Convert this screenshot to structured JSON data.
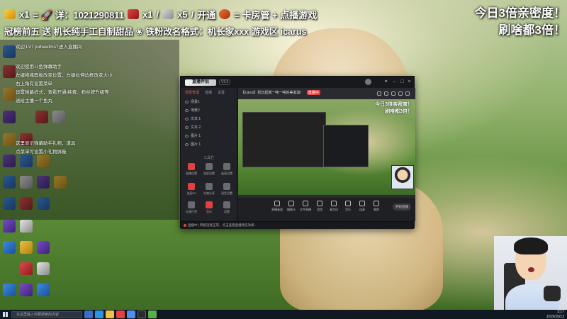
{
  "top_banner": {
    "line1": {
      "gift_count_1": "x1",
      "text": "= 🚀 详：1021290811",
      "gift_count_2": "x1",
      "gift_count_3": "x5",
      "open_text": "开通",
      "equals_card": "= 卡房管 + 点播游戏"
    },
    "line2": "冠榜前五 送 机长纯手工自制甜品 ❀ 铁粉改名格式：机长家xxx 游戏区 icarus"
  },
  "top_right": {
    "line1": "今日3倍亲密度！",
    "line2": "刷啥都3倍！"
  },
  "chat": {
    "messages": [
      "欢迎 LV7 judwedmsT进入直播间",
      "欢迎使用斗鱼弹幕助手",
      "左键拖拽面板改变位置，左键拉伸边框改变大小",
      "右上角有设置菜单",
      "设置弹幕样式，查看开通/续费、粉丝牌升级等",
      "送给主播一个鱼丸",
      "这里显示弹幕助手礼物，道具",
      "点菜单可设置小礼物屏蔽"
    ]
  },
  "app": {
    "logo": "直播伴侣",
    "version": "V2.0",
    "tabs": [
      "场景管理",
      "直播",
      "设置"
    ],
    "scenes": [
      "场景1",
      "场景2",
      "文本 1",
      "文本 2",
      "图片 1",
      "图片 1"
    ],
    "tools_label": "工具栏",
    "tools": [
      {
        "label": "直播设置",
        "active": true
      },
      {
        "label": "录屏设置",
        "active": false
      },
      {
        "label": "画面设置",
        "active": false
      },
      {
        "label": "连麦PK",
        "active": true
      },
      {
        "label": "礼物分享",
        "active": false
      },
      {
        "label": "语音设置",
        "active": false
      },
      {
        "label": "礼物打赏",
        "active": false
      },
      {
        "label": "音乐",
        "active": true
      },
      {
        "label": "设置",
        "active": false
      }
    ],
    "room_title": "【icarus】机长起锅一吨一吨的美滋滋！",
    "room_tag": "直播中",
    "preview_top_right_1": "今日3倍亲密度！",
    "preview_top_right_2": "刷啥都3倍！",
    "bottom_buttons": [
      "直播画面",
      "摄像头",
      "文件直播",
      "游戏",
      "麦克风",
      "音乐",
      "连麦",
      "美颜"
    ],
    "start_live": "开始直播",
    "status_text": "直播中 | 网络连接正常，点击查看直播预览效果..."
  },
  "taskbar": {
    "search_placeholder": "在这里输入你要搜索的内容",
    "time": "3:17",
    "date": "2019/10/12"
  }
}
